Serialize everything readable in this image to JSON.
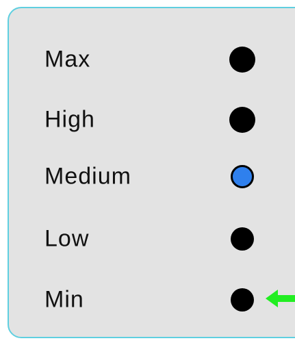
{
  "options": [
    {
      "label": "Max",
      "selected": false
    },
    {
      "label": "High",
      "selected": false
    },
    {
      "label": "Medium",
      "selected": true
    },
    {
      "label": "Low",
      "selected": false
    },
    {
      "label": "Min",
      "selected": false
    }
  ],
  "colors": {
    "panel_border": "#5fcfe0",
    "panel_background": "#e3e3e3",
    "radio_default": "#000000",
    "radio_selected": "#2f80ed",
    "pointer_arrow": "#22ee22"
  },
  "icons": {
    "pointer": "arrow-left-icon"
  }
}
